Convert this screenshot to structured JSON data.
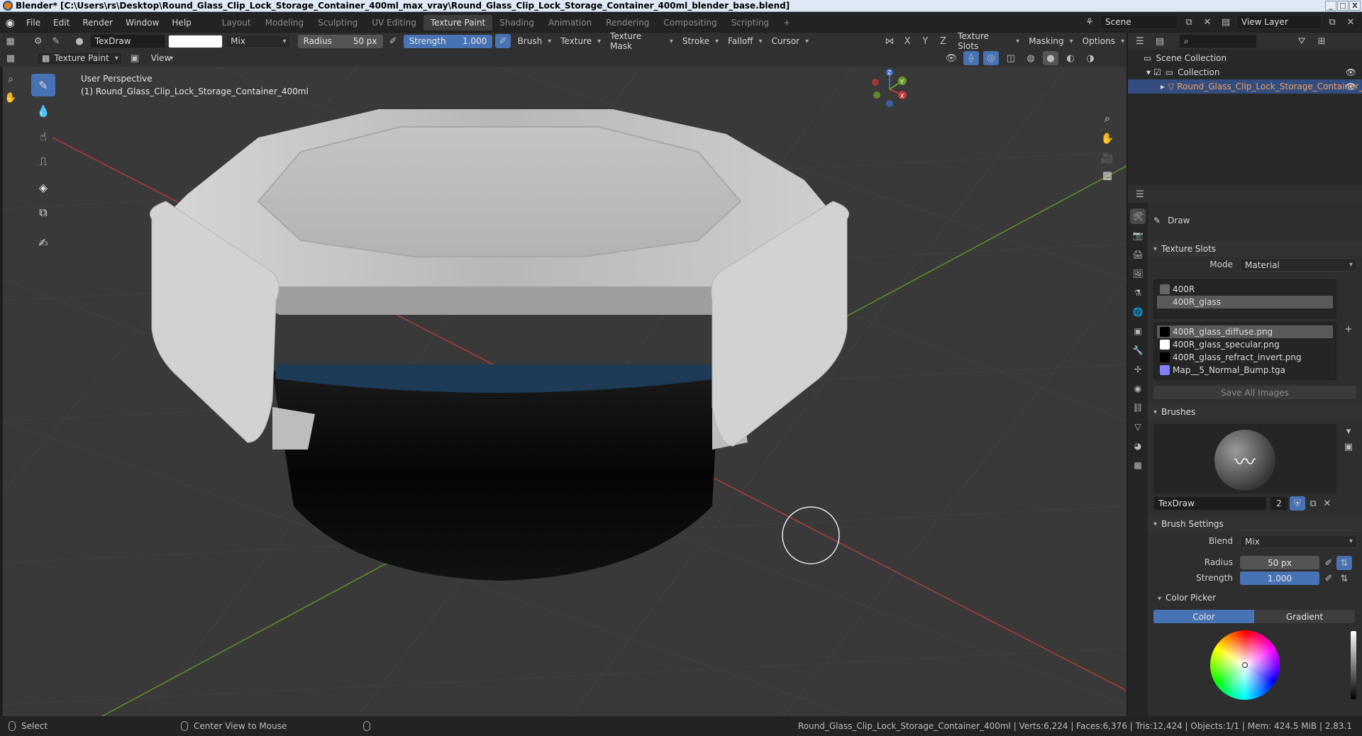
{
  "window": {
    "title": "Blender* [C:\\Users\\rs\\Desktop\\Round_Glass_Clip_Lock_Storage_Container_400ml_max_vray\\Round_Glass_Clip_Lock_Storage_Container_400ml_blender_base.blend]",
    "min": "_",
    "max": "□",
    "close": "X"
  },
  "menu": {
    "file": "File",
    "edit": "Edit",
    "render": "Render",
    "window": "Window",
    "help": "Help"
  },
  "workspaces": [
    "Layout",
    "Modeling",
    "Sculpting",
    "UV Editing",
    "Texture Paint",
    "Shading",
    "Animation",
    "Rendering",
    "Compositing",
    "Scripting"
  ],
  "active_workspace": "Texture Paint",
  "add_workspace": "+",
  "scene": {
    "name": "Scene",
    "view_layer": "View Layer"
  },
  "toolheader": {
    "brush_name": "TexDraw",
    "blend": "Mix",
    "radius_label": "Radius",
    "radius_value": "50 px",
    "strength_label": "Strength",
    "strength_value": "1.000",
    "brush": "Brush",
    "texture": "Texture",
    "texture_mask": "Texture Mask",
    "stroke": "Stroke",
    "falloff": "Falloff",
    "cursor": "Cursor",
    "x": "X",
    "y": "Y",
    "z": "Z",
    "texture_slots": "Texture Slots",
    "masking": "Masking",
    "options": "Options"
  },
  "header2": {
    "mode": "Texture Paint",
    "view": "View"
  },
  "viewport": {
    "perspective": "User Perspective",
    "object_label": "(1) Round_Glass_Clip_Lock_Storage_Container_400ml",
    "axis_x": "X",
    "axis_y": "Y",
    "axis_z": "Z"
  },
  "outliner": {
    "scene_collection": "Scene Collection",
    "collection": "Collection",
    "object": "Round_Glass_Clip_Lock_Storage_Container_"
  },
  "properties": {
    "tool_name": "Draw",
    "texture_slots_title": "Texture Slots",
    "mode_label": "Mode",
    "mode_value": "Material",
    "materials": [
      "400R",
      "400R_glass"
    ],
    "selected_material": "400R_glass",
    "images": [
      {
        "name": "400R_glass_diffuse.png",
        "color": "#000000"
      },
      {
        "name": "400R_glass_specular.png",
        "color": "#ffffff"
      },
      {
        "name": "400R_glass_refract_invert.png",
        "color": "#000000"
      },
      {
        "name": "Map__5_Normal_Bump.tga",
        "color": "#7f7fff"
      }
    ],
    "save_all": "Save All Images",
    "brushes_title": "Brushes",
    "brush_name": "TexDraw",
    "brush_users": "2",
    "brush_settings_title": "Brush Settings",
    "blend_label": "Blend",
    "blend_value": "Mix",
    "radius_label": "Radius",
    "radius_value": "50 px",
    "strength_label": "Strength",
    "strength_value": "1.000",
    "color_picker_title": "Color Picker",
    "color_tab": "Color",
    "gradient_tab": "Gradient"
  },
  "status": {
    "select": "Select",
    "center_view": "Center View to Mouse",
    "stats": "Round_Glass_Clip_Lock_Storage_Container_400ml | Verts:6,224 | Faces:6,376 | Tris:12,424 | Objects:1/1 | Mem: 424.5 MiB | 2.83.1"
  },
  "colors": {
    "accent": "#4772b3",
    "selection": "#334d80",
    "viewport_bg": "#393939",
    "axis_red": "#c0393b",
    "axis_green": "#6b9c2b"
  }
}
